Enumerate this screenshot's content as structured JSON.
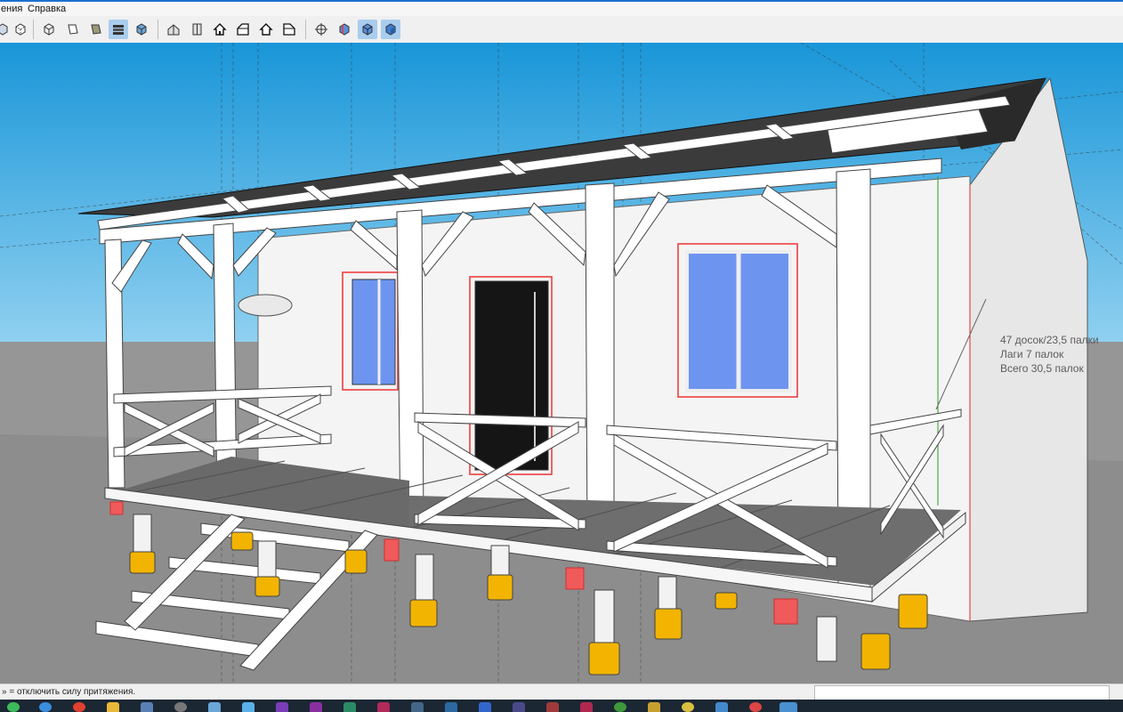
{
  "menubar": {
    "items": [
      {
        "label": "ения"
      },
      {
        "label": "Справка"
      }
    ]
  },
  "toolbar": {
    "buttons": [
      {
        "name": "x-ray-style-button",
        "icon": "xray-cube-icon"
      },
      {
        "name": "back-edges-style-button",
        "icon": "back-edges-cube-icon"
      },
      {
        "name": "wireframe-style-button",
        "icon": "wireframe-cube-icon"
      },
      {
        "name": "hidden-line-style-button",
        "icon": "hidden-line-cube-icon"
      },
      {
        "name": "shaded-style-button",
        "icon": "shaded-cube-icon"
      },
      {
        "name": "shaded-textures-style-button",
        "icon": "textured-cube-icon"
      },
      {
        "name": "monochrome-style-button",
        "icon": "monochrome-cube-icon"
      },
      {
        "name": "iso-view-button",
        "icon": "iso-house-icon"
      },
      {
        "name": "top-view-button",
        "icon": "top-house-icon"
      },
      {
        "name": "front-view-button",
        "icon": "front-house-icon"
      },
      {
        "name": "right-view-button",
        "icon": "right-house-icon"
      },
      {
        "name": "back-view-button",
        "icon": "back-house-icon"
      },
      {
        "name": "left-view-button",
        "icon": "left-house-icon"
      },
      {
        "name": "section-plane-button",
        "icon": "section-plane-icon"
      },
      {
        "name": "display-section-planes-button",
        "icon": "section-display-icon"
      },
      {
        "name": "display-section-cuts-button",
        "icon": "section-cut-icon"
      },
      {
        "name": "display-section-fill-button",
        "icon": "section-fill-icon"
      }
    ]
  },
  "annotation": {
    "lines": [
      "47 досок/23,5 палки",
      "Лаги 7 палок",
      "Всего 30,5 палок"
    ]
  },
  "status": {
    "text": "» = отключить силу притяжения.",
    "measurements_value": ""
  },
  "colors": {
    "sky": "#3aa4de",
    "ground": "#8c8c8c",
    "wall": "#f4f4f4",
    "timber": "#ffffff",
    "deck": "#6e6e6e",
    "roof": "#3a3a3a",
    "glass": "#6d95f0",
    "door": "#151515",
    "footing": "#f2b400",
    "accent_red": "#f05a5a",
    "selection": "#a9cdee"
  }
}
